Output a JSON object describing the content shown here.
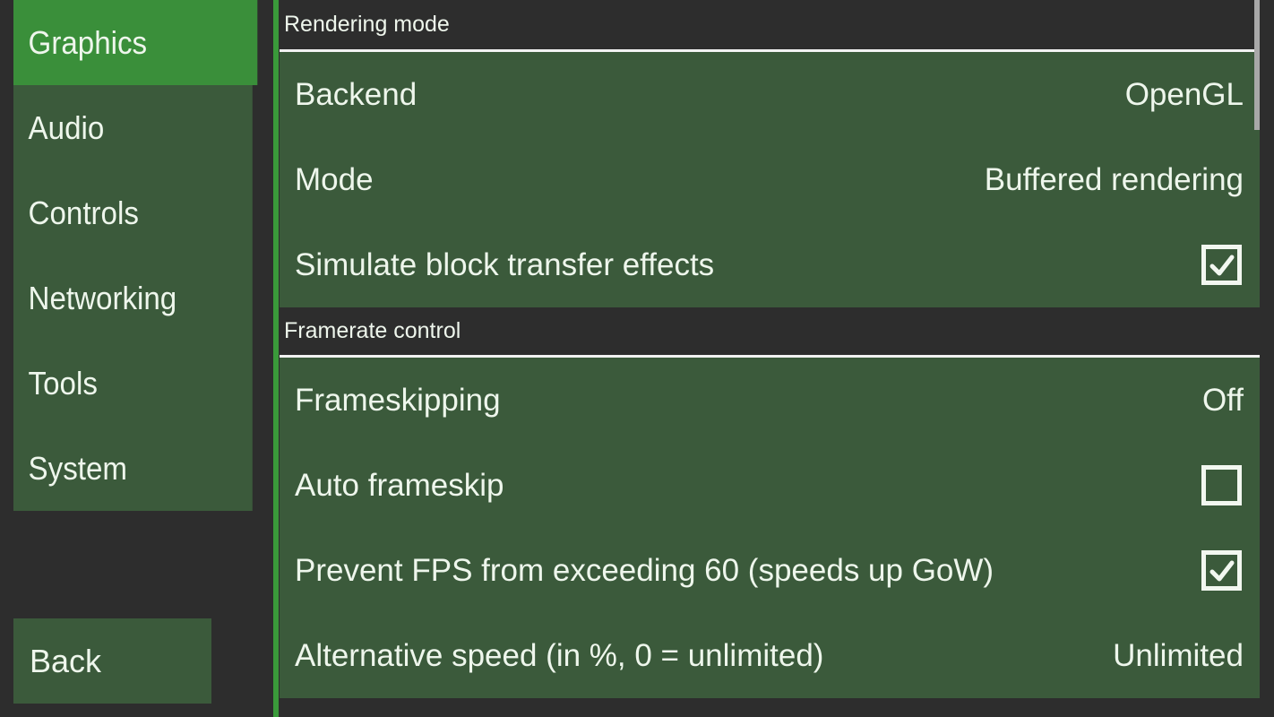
{
  "sidebar": {
    "tabs": [
      {
        "label": "Graphics",
        "selected": true
      },
      {
        "label": "Audio",
        "selected": false
      },
      {
        "label": "Controls",
        "selected": false
      },
      {
        "label": "Networking",
        "selected": false
      },
      {
        "label": "Tools",
        "selected": false
      },
      {
        "label": "System",
        "selected": false
      }
    ],
    "back_label": "Back"
  },
  "sections": [
    {
      "title": "Rendering mode",
      "items": [
        {
          "label": "Backend",
          "type": "value",
          "value": "OpenGL"
        },
        {
          "label": "Mode",
          "type": "value",
          "value": "Buffered rendering"
        },
        {
          "label": "Simulate block transfer effects",
          "type": "checkbox",
          "checked": true
        }
      ]
    },
    {
      "title": "Framerate control",
      "items": [
        {
          "label": "Frameskipping",
          "type": "value",
          "value": "Off"
        },
        {
          "label": "Auto frameskip",
          "type": "checkbox",
          "checked": false
        },
        {
          "label": "Prevent FPS from exceeding 60 (speeds up GoW)",
          "type": "checkbox",
          "checked": true
        },
        {
          "label": "Alternative speed (in %, 0 = unlimited)",
          "type": "value",
          "value": "Unlimited"
        }
      ]
    }
  ],
  "colors": {
    "background": "#2d2d2d",
    "item": "#3b5a3b",
    "selected": "#3a8f3a",
    "divider": "#3a9a3a"
  }
}
